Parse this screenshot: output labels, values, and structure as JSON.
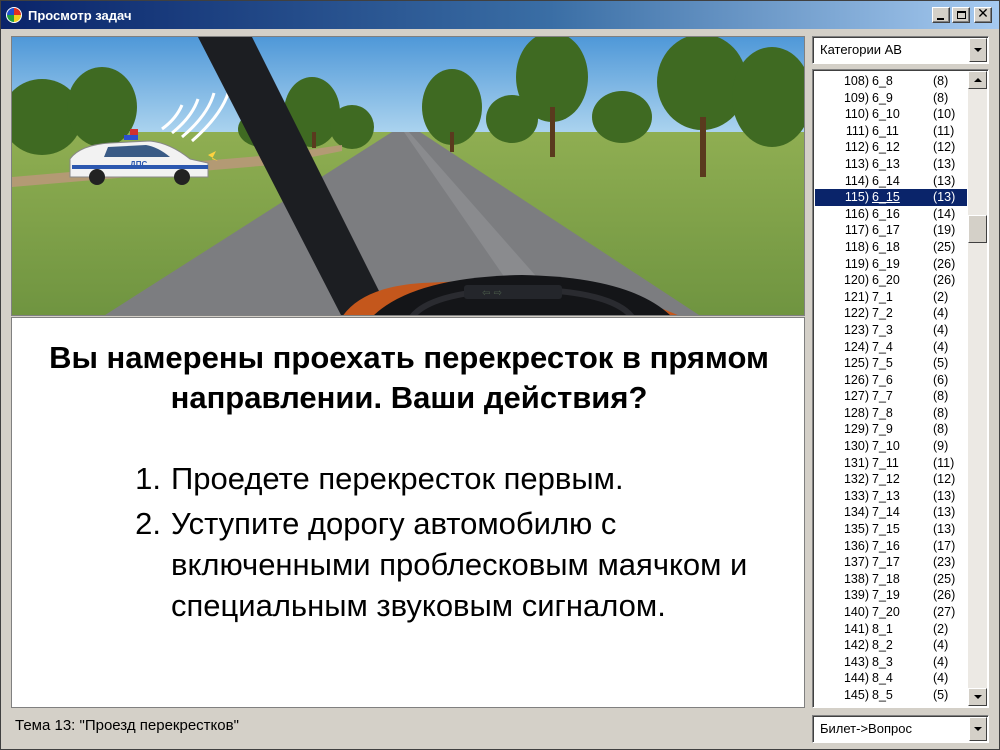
{
  "window": {
    "title": "Просмотр задач"
  },
  "scene": {
    "car_label": "ДПС"
  },
  "question": {
    "text": "Вы намерены проехать перекресток в прямом направлении. Ваши действия?",
    "answers": [
      {
        "num": "1.",
        "text": "Проедете перекресток первым."
      },
      {
        "num": "2.",
        "text": "Уступите дорогу автомобилю с включенными проблесковым маячком и специальным звуковым сигналом."
      }
    ]
  },
  "status": {
    "topic": "Тема 13: \"Проезд перекрестков\""
  },
  "category_combo": {
    "value": "Категории АВ"
  },
  "mode_combo": {
    "value": "Билет->Вопрос"
  },
  "task_list": {
    "selected_index": 7,
    "scroll_position": 0.22,
    "items": [
      {
        "no": "108)",
        "code": "6_8",
        "count": "(8)"
      },
      {
        "no": "109)",
        "code": "6_9",
        "count": "(8)"
      },
      {
        "no": "110)",
        "code": "6_10",
        "count": "(10)"
      },
      {
        "no": "111)",
        "code": "6_11",
        "count": "(11)"
      },
      {
        "no": "112)",
        "code": "6_12",
        "count": "(12)"
      },
      {
        "no": "113)",
        "code": "6_13",
        "count": "(13)"
      },
      {
        "no": "114)",
        "code": "6_14",
        "count": "(13)"
      },
      {
        "no": "115)",
        "code": "6_15",
        "count": "(13)"
      },
      {
        "no": "116)",
        "code": "6_16",
        "count": "(14)"
      },
      {
        "no": "117)",
        "code": "6_17",
        "count": "(19)"
      },
      {
        "no": "118)",
        "code": "6_18",
        "count": "(25)"
      },
      {
        "no": "119)",
        "code": "6_19",
        "count": "(26)"
      },
      {
        "no": "120)",
        "code": "6_20",
        "count": "(26)"
      },
      {
        "no": "121)",
        "code": "7_1",
        "count": "(2)"
      },
      {
        "no": "122)",
        "code": "7_2",
        "count": "(4)"
      },
      {
        "no": "123)",
        "code": "7_3",
        "count": "(4)"
      },
      {
        "no": "124)",
        "code": "7_4",
        "count": "(4)"
      },
      {
        "no": "125)",
        "code": "7_5",
        "count": "(5)"
      },
      {
        "no": "126)",
        "code": "7_6",
        "count": "(6)"
      },
      {
        "no": "127)",
        "code": "7_7",
        "count": "(8)"
      },
      {
        "no": "128)",
        "code": "7_8",
        "count": "(8)"
      },
      {
        "no": "129)",
        "code": "7_9",
        "count": "(8)"
      },
      {
        "no": "130)",
        "code": "7_10",
        "count": "(9)"
      },
      {
        "no": "131)",
        "code": "7_11",
        "count": "(11)"
      },
      {
        "no": "132)",
        "code": "7_12",
        "count": "(12)"
      },
      {
        "no": "133)",
        "code": "7_13",
        "count": "(13)"
      },
      {
        "no": "134)",
        "code": "7_14",
        "count": "(13)"
      },
      {
        "no": "135)",
        "code": "7_15",
        "count": "(13)"
      },
      {
        "no": "136)",
        "code": "7_16",
        "count": "(17)"
      },
      {
        "no": "137)",
        "code": "7_17",
        "count": "(23)"
      },
      {
        "no": "138)",
        "code": "7_18",
        "count": "(25)"
      },
      {
        "no": "139)",
        "code": "7_19",
        "count": "(26)"
      },
      {
        "no": "140)",
        "code": "7_20",
        "count": "(27)"
      },
      {
        "no": "141)",
        "code": "8_1",
        "count": "(2)"
      },
      {
        "no": "142)",
        "code": "8_2",
        "count": "(4)"
      },
      {
        "no": "143)",
        "code": "8_3",
        "count": "(4)"
      },
      {
        "no": "144)",
        "code": "8_4",
        "count": "(4)"
      },
      {
        "no": "145)",
        "code": "8_5",
        "count": "(5)"
      }
    ]
  }
}
